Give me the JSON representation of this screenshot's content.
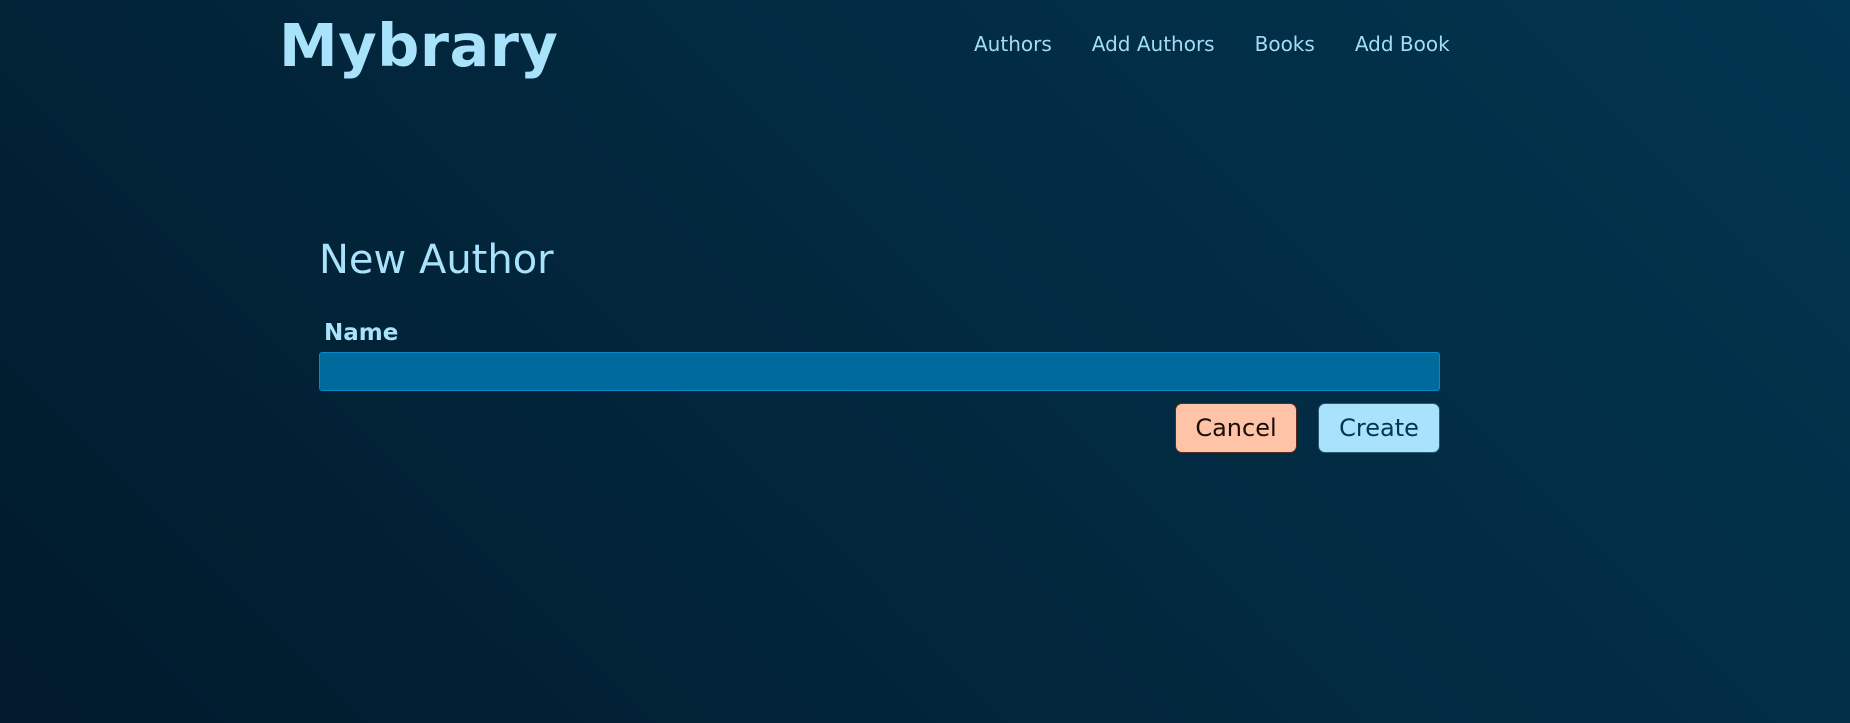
{
  "header": {
    "logo": "Mybrary",
    "nav": [
      {
        "label": "Authors"
      },
      {
        "label": "Add Authors"
      },
      {
        "label": "Books"
      },
      {
        "label": "Add Book"
      }
    ]
  },
  "main": {
    "title": "New Author",
    "form": {
      "name_label": "Name",
      "name_value": "",
      "name_placeholder": "",
      "cancel_label": "Cancel",
      "create_label": "Create"
    }
  },
  "colors": {
    "background_dark": "#011a2c",
    "background_light": "#023550",
    "text_accent": "#a8e2fb",
    "input_background": "#016a9d",
    "cancel_button": "#ffc3a8",
    "create_button": "#a8e2fb"
  }
}
